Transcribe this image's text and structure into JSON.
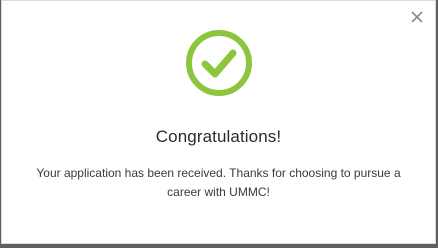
{
  "dialog": {
    "title": "Congratulations!",
    "message": "Your application has been received.  Thanks for choosing to pursue a career with UMMC!",
    "close_icon": "close-icon",
    "status_icon": "checkmark-circle-icon",
    "accent_color": "#8cc63f"
  }
}
